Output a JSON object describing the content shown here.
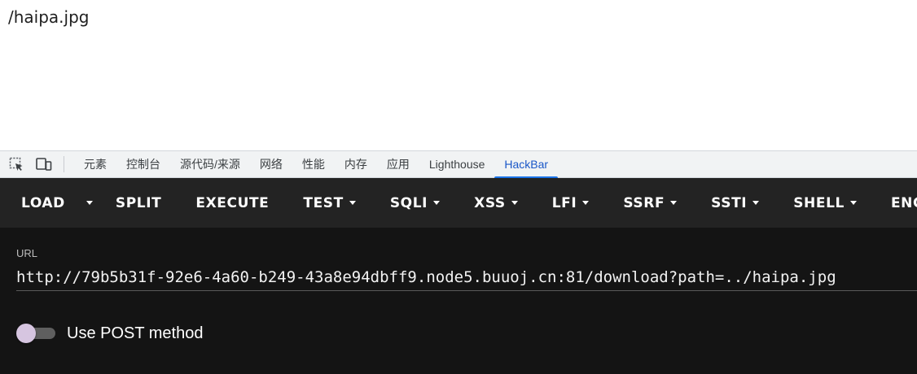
{
  "page": {
    "text": "/haipa.jpg"
  },
  "devtools": {
    "icons": [
      "inspect-element-icon",
      "device-toolbar-icon"
    ],
    "tabs": [
      {
        "label": "元素",
        "active": false
      },
      {
        "label": "控制台",
        "active": false
      },
      {
        "label": "源代码/来源",
        "active": false
      },
      {
        "label": "网络",
        "active": false
      },
      {
        "label": "性能",
        "active": false
      },
      {
        "label": "内存",
        "active": false
      },
      {
        "label": "应用",
        "active": false
      },
      {
        "label": "Lighthouse",
        "active": false
      },
      {
        "label": "HackBar",
        "active": true
      }
    ],
    "active_tab_color": "#1a73e8"
  },
  "hackbar": {
    "toolbar": {
      "load": "LOAD",
      "split": "SPLIT",
      "execute": "EXECUTE",
      "test": "TEST",
      "sqli": "SQLI",
      "xss": "XSS",
      "lfi": "LFI",
      "ssrf": "SSRF",
      "ssti": "SSTI",
      "shell": "SHELL",
      "encoding": "ENCODING"
    },
    "url_label": "URL",
    "url_value": "http://79b5b31f-92e6-4a60-b249-43a8e94dbff9.node5.buuoj.cn:81/download?path=../haipa.jpg",
    "post_label": "Use POST method",
    "post_enabled": false,
    "colors": {
      "toolbar_bg": "#232323",
      "body_bg": "#141414",
      "switch_thumb": "#d6c5e0"
    }
  }
}
